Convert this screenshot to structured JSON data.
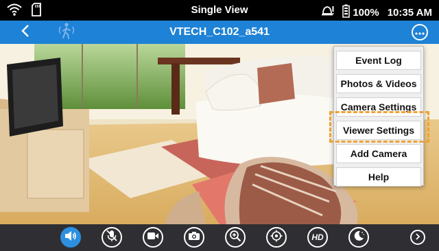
{
  "status_bar": {
    "title": "Single View",
    "battery": "100%",
    "time": "10:35 AM",
    "icons": [
      "wifi-icon",
      "sd-card-icon",
      "alert-icon",
      "battery-icon"
    ]
  },
  "nav_bar": {
    "title": "VTECH_C102_a541",
    "icons": [
      "back-icon",
      "motion-detection-icon",
      "more-options-icon"
    ]
  },
  "menu": {
    "items": [
      {
        "label": "Event Log"
      },
      {
        "label": "Photos & Videos"
      },
      {
        "label": "Camera Settings"
      },
      {
        "label": "Viewer Settings",
        "highlighted": true
      },
      {
        "label": "Add Camera"
      },
      {
        "label": "Help"
      }
    ]
  },
  "toolbar": {
    "hd_label": "HD",
    "buttons": [
      "speaker-icon",
      "mute-mic-icon",
      "video-record-icon",
      "camera-snapshot-icon",
      "zoom-icon",
      "pan-target-icon",
      "hd-icon",
      "night-mode-icon",
      "next-icon"
    ],
    "active": "speaker-icon"
  },
  "colors": {
    "nav_bar": "#1e82d6",
    "highlight": "#f0a233",
    "toolbar": "#2f2f33",
    "active_button": "#2d8fe0"
  }
}
